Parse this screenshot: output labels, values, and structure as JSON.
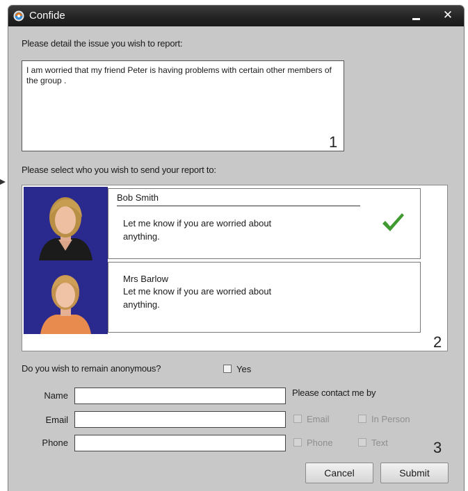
{
  "window": {
    "title": "Confide"
  },
  "report": {
    "prompt": "Please detail the issue you wish to report:",
    "text": "I am worried that my friend Peter is having problems with certain other members of the group .",
    "step": "1"
  },
  "recipients": {
    "prompt": "Please select who you wish to send your report to:",
    "step": "2",
    "items": [
      {
        "name": "Bob Smith",
        "message": "Let me know if you are worried about anything.",
        "selected": true
      },
      {
        "name": "Mrs Barlow",
        "message": "Let me know if you are worried about anything.",
        "selected": false
      }
    ]
  },
  "anonymous": {
    "question": "Do you wish to remain anonymous?",
    "option": "Yes"
  },
  "contact_form": {
    "name_label": "Name",
    "name_value": "",
    "email_label": "Email",
    "email_value": "",
    "phone_label": "Phone",
    "phone_value": "",
    "contact_prompt": "Please contact me by",
    "methods": [
      "Email",
      "In Person",
      "Phone",
      "Text"
    ],
    "step": "3"
  },
  "buttons": {
    "cancel": "Cancel",
    "submit": "Submit"
  },
  "colors": {
    "check": "#3f9a2f",
    "photo_bg": "#2a2a8e",
    "titlebar": "#222222",
    "dialog_bg": "#c8c8c8"
  }
}
